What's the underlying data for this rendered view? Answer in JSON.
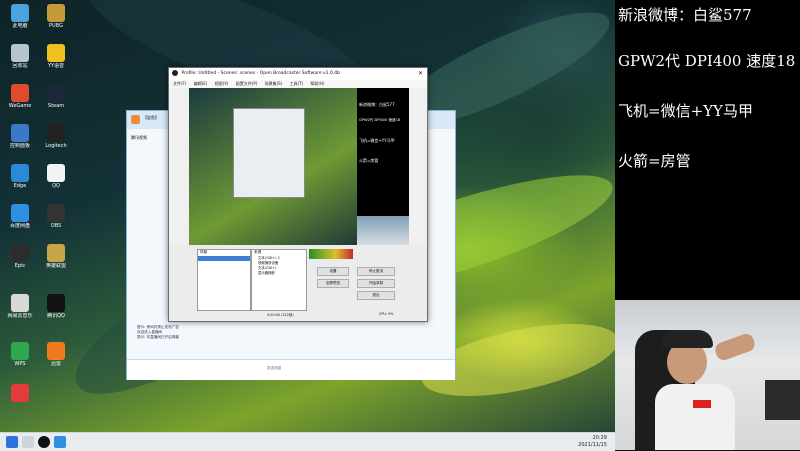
{
  "overlay": {
    "line1": "新浪微博：白鲨577",
    "line2": "GPW2代 DPI400 速度18",
    "line3": "飞机=微信+YY马甲",
    "line4": "火箭=房管"
  },
  "obs": {
    "title": "Profile: Untitled - Scenes: scenes - Open Broadcaster Software v1.0.4b",
    "menu": [
      "文件(F)",
      "编辑(E)",
      "视图(V)",
      "配置文件(P)",
      "场景集(S)",
      "工具(T)",
      "帮助(H)"
    ],
    "overlay_lines": [
      "新浪微博：白鲨577",
      "GPW2代 DPI400 速度18",
      "飞机=微信+YY马甲",
      "火箭=房管"
    ],
    "scenes_header": "场景",
    "sources_header": "来源",
    "sources": [
      "文本(GDI+) 2",
      "视频捕获设备",
      "文本(GDI+)",
      "显示器捕获"
    ],
    "buttons": [
      "设置",
      "停止推流",
      "全屏预览",
      "开始录制",
      "退出"
    ],
    "status_left": "0:00:00 (522帧)",
    "status_right": "CPU: 9%"
  },
  "qq": {
    "title": "【鲨鱼】",
    "group": "腾讯视频",
    "messages": [
      "提示: 房间内禁止发布广告",
      "欢迎进入直播间",
      "提示: 本直播间已开启弹幕"
    ],
    "input_placeholder": "发送消息"
  },
  "desktop": {
    "icons": [
      "此电脑",
      "PUBG",
      "回收站",
      "YY语音",
      "WeGame",
      "Steam",
      "控制面板",
      "Logitech",
      "Edge",
      "QQ",
      "百度网盘",
      "OBS",
      "Epic",
      "英雄联盟",
      "网易云音乐",
      "腾讯QQ",
      "WPS",
      "迅雷"
    ],
    "clock_time": "20:29",
    "clock_date": "2021/11/15"
  },
  "colors": {
    "overlay_text": "#ffffff",
    "panel_bg": "#000000",
    "taskbar": "#e8ecef"
  }
}
